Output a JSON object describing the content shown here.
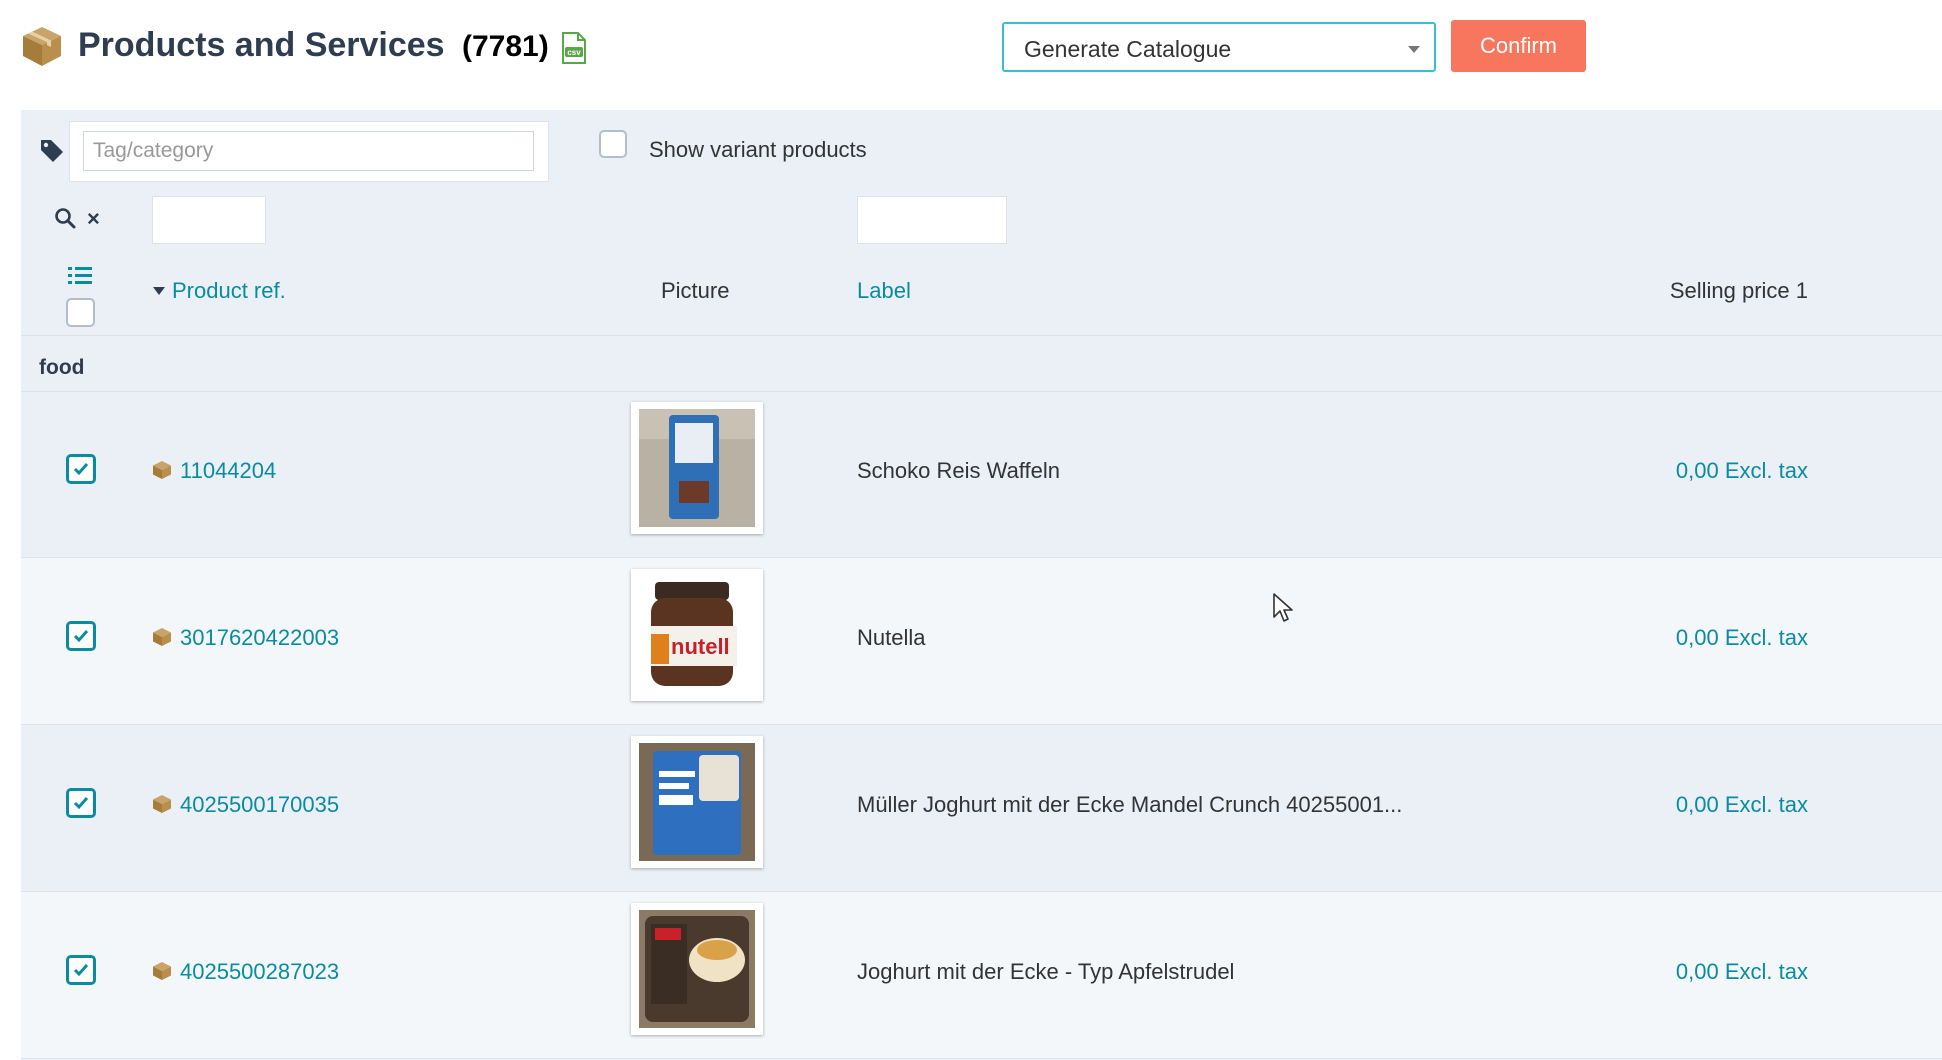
{
  "header": {
    "title": "Products and Services",
    "count": "(7781)",
    "box_icon": "box-icon",
    "csv_icon": "csv-export-icon"
  },
  "mass_action": {
    "selected": "Generate Catalogue",
    "confirm_label": "Confirm"
  },
  "filters": {
    "tag_placeholder": "Tag/category",
    "variant_label": "Show variant products",
    "variant_checked": false,
    "ref_filter_value": "",
    "label_filter_value": ""
  },
  "columns": {
    "ref": "Product ref.",
    "picture": "Picture",
    "label": "Label",
    "price": "Selling price 1"
  },
  "group": "food",
  "rows": [
    {
      "ref": "11044204",
      "label": "Schoko Reis Waffeln",
      "price": "0,00 Excl. tax",
      "checked": true
    },
    {
      "ref": "3017620422003",
      "label": "Nutella",
      "price": "0,00 Excl. tax",
      "checked": true
    },
    {
      "ref": "4025500170035",
      "label": "Müller Joghurt mit der Ecke Mandel Crunch 40255001...",
      "price": "0,00 Excl. tax",
      "checked": true
    },
    {
      "ref": "4025500287023",
      "label": "Joghurt mit der Ecke - Typ Apfelstrudel",
      "price": "0,00 Excl. tax",
      "checked": true
    }
  ],
  "colors": {
    "accent": "#0b8ba0",
    "confirm": "#f8765d",
    "select_border": "#35c0cf",
    "panel_bg": "#eaf0f6"
  }
}
